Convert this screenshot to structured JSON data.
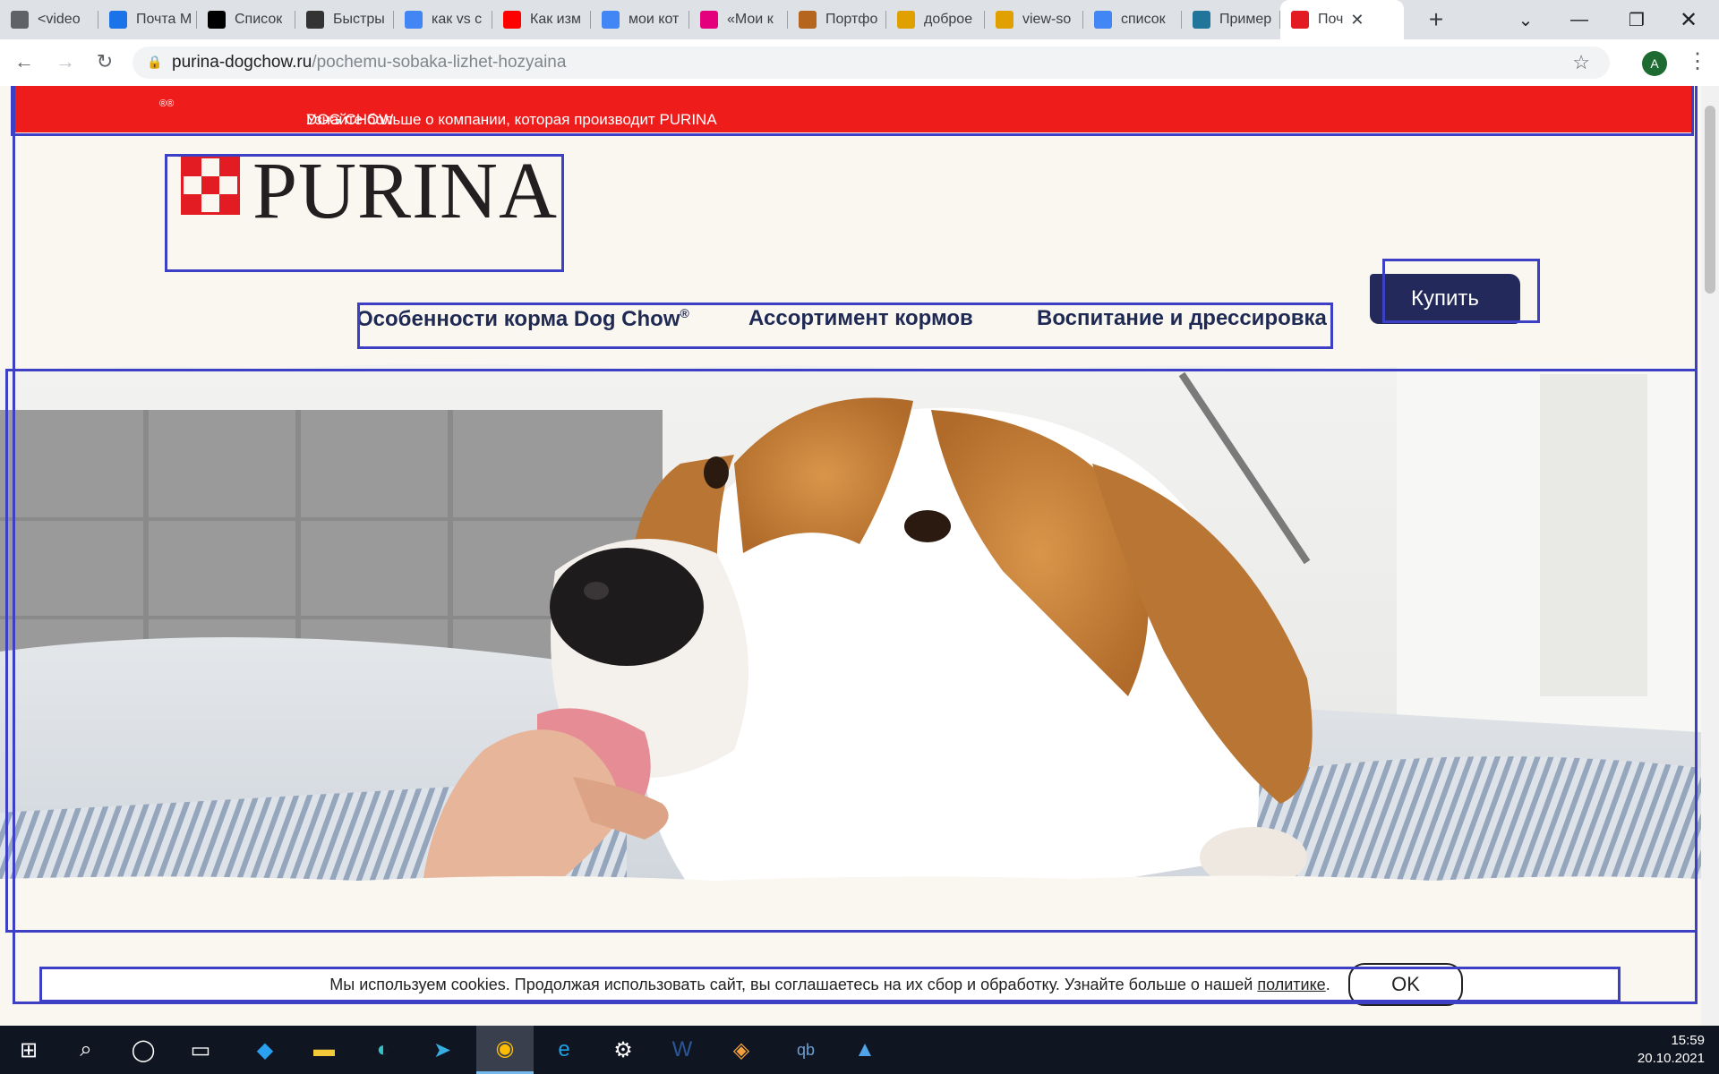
{
  "browser": {
    "tabs": [
      {
        "title": "<video",
        "icon": "chat-icon",
        "color": "#5f6368"
      },
      {
        "title": "Почта М",
        "icon": "mail-icon",
        "color": "#1a73e8"
      },
      {
        "title": "Список",
        "icon": "tb-icon",
        "color": "#000000"
      },
      {
        "title": "Быстры",
        "icon": "chart-icon",
        "color": "#333333"
      },
      {
        "title": "как vs c",
        "icon": "google-icon",
        "color": "#4285f4"
      },
      {
        "title": "Как изм",
        "icon": "youtube-icon",
        "color": "#ff0000"
      },
      {
        "title": "мои кот",
        "icon": "google-icon",
        "color": "#4285f4"
      },
      {
        "title": "«Мои к",
        "icon": "z-icon",
        "color": "#e4007c"
      },
      {
        "title": "Портфо",
        "icon": "avatar-icon",
        "color": "#b5651d"
      },
      {
        "title": "доброе",
        "icon": "triangle-icon",
        "color": "#e0a100"
      },
      {
        "title": "view-so",
        "icon": "triangle-icon",
        "color": "#e0a100"
      },
      {
        "title": "список",
        "icon": "google-icon",
        "color": "#4285f4"
      },
      {
        "title": "Пример",
        "icon": "wordpress-icon",
        "color": "#21759b"
      },
      {
        "title": "Поч",
        "icon": "purina-icon",
        "color": "#e31b23"
      }
    ],
    "url_domain": "purina-dogchow.ru",
    "url_path": "/pochemu-sobaka-lizhet-hozyaina",
    "profile_initial": "A"
  },
  "page": {
    "top_banner": "Узнайте больше о компании, которая производит PURINA",
    "top_banner_mid": " DOG CHOW",
    "registered": "®",
    "logo_text": "PURINA",
    "nav": [
      {
        "label": "Особенности корма Dog Chow",
        "sup": "®"
      },
      {
        "label": "Ассортимент кормов",
        "sup": ""
      },
      {
        "label": "Воспитание и дрессировка",
        "sup": ""
      }
    ],
    "buy_label": "Купить",
    "cookie_text": "Мы используем cookies. Продолжая использовать сайт, вы соглашаетесь на их сбор и обработку. Узнайте больше о нашей",
    "cookie_link": "политике",
    "cookie_end": ".",
    "ok_label": "OK",
    "colors": {
      "banner_red": "#ef1c1c",
      "navy": "#23295a",
      "page_bg": "#faf7f1"
    }
  },
  "taskbar": {
    "time": "15:59",
    "date": "20.10.2021",
    "apps": [
      "windows-start-icon",
      "search-icon",
      "cortana-icon",
      "task-view-icon",
      "vscode-icon",
      "file-explorer-icon",
      "edge-icon",
      "telegram-icon",
      "chrome-icon",
      "ie-icon",
      "settings-icon",
      "word-icon",
      "git-icon",
      "qbittorrent-icon",
      "photos-icon"
    ]
  }
}
